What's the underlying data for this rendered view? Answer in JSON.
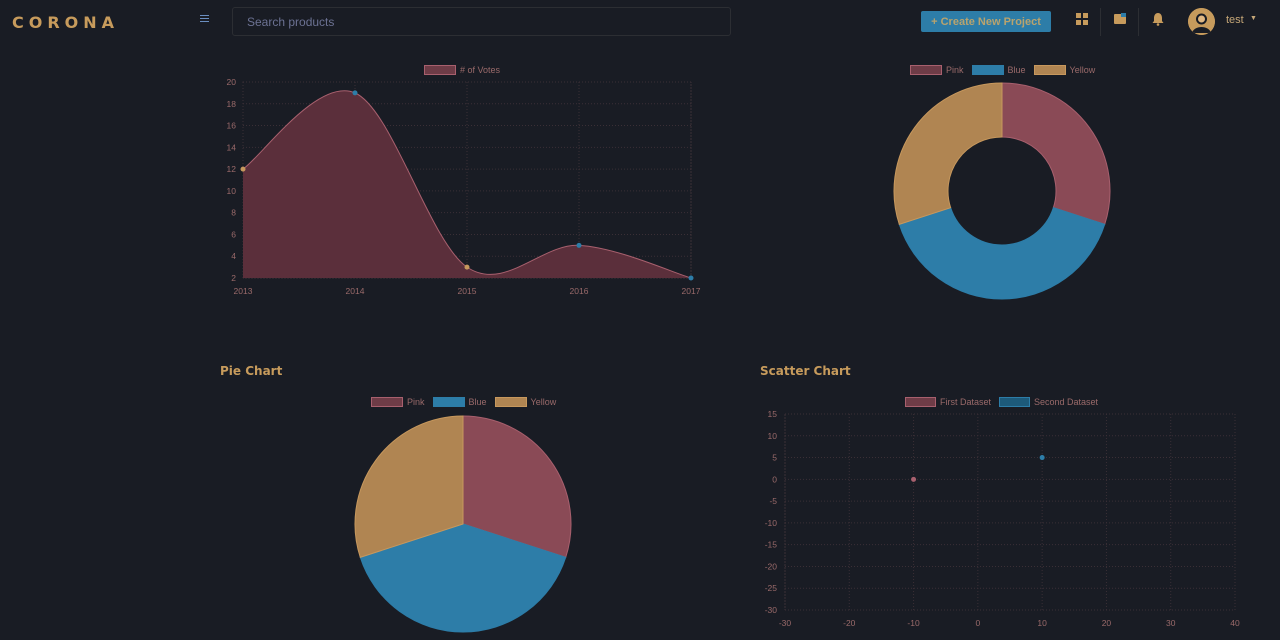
{
  "header": {
    "brand": "CORONA",
    "search_placeholder": "Search products",
    "create_button": "+ Create New Project",
    "user_name": "test"
  },
  "colors": {
    "background": "#191c24",
    "pink": "#a8606e",
    "blue": "#2d7da8",
    "yellow": "#c7985d",
    "accent": "#c79b5c"
  },
  "area_chart": {
    "legend": "# of Votes"
  },
  "doughnut_chart": {
    "legend": [
      "Pink",
      "Blue",
      "Yellow"
    ]
  },
  "pie_card": {
    "title": "Pie Chart",
    "legend": [
      "Pink",
      "Blue",
      "Yellow"
    ]
  },
  "scatter_card": {
    "title": "Scatter Chart",
    "legend": [
      "First Dataset",
      "Second Dataset"
    ]
  },
  "chart_data": [
    {
      "type": "area",
      "categories": [
        "2013",
        "2014",
        "2015",
        "2016",
        "2017"
      ],
      "series": [
        {
          "name": "# of Votes",
          "values": [
            12,
            19,
            3,
            5,
            2
          ]
        }
      ],
      "ylim": [
        2,
        20
      ],
      "yticks": [
        2,
        4,
        6,
        8,
        10,
        12,
        14,
        16,
        18,
        20
      ],
      "grid": true,
      "legend": "top"
    },
    {
      "type": "pie",
      "variant": "doughnut",
      "labels": [
        "Pink",
        "Blue",
        "Yellow"
      ],
      "values": [
        30,
        40,
        30
      ],
      "legend": "top"
    },
    {
      "type": "pie",
      "labels": [
        "Pink",
        "Blue",
        "Yellow"
      ],
      "values": [
        30,
        40,
        30
      ],
      "legend": "top"
    },
    {
      "type": "scatter",
      "series": [
        {
          "name": "First Dataset",
          "points": [
            [
              -10,
              0
            ]
          ]
        },
        {
          "name": "Second Dataset",
          "points": [
            [
              10,
              5
            ]
          ]
        }
      ],
      "xlim": [
        -30,
        40
      ],
      "xticks": [
        -30,
        -20,
        -10,
        0,
        10,
        20,
        30,
        40
      ],
      "ylim": [
        -30,
        15
      ],
      "yticks": [
        15,
        10,
        5,
        0,
        -5,
        -10,
        -15,
        -20,
        -25,
        -30
      ],
      "grid": true,
      "legend": "top"
    }
  ]
}
